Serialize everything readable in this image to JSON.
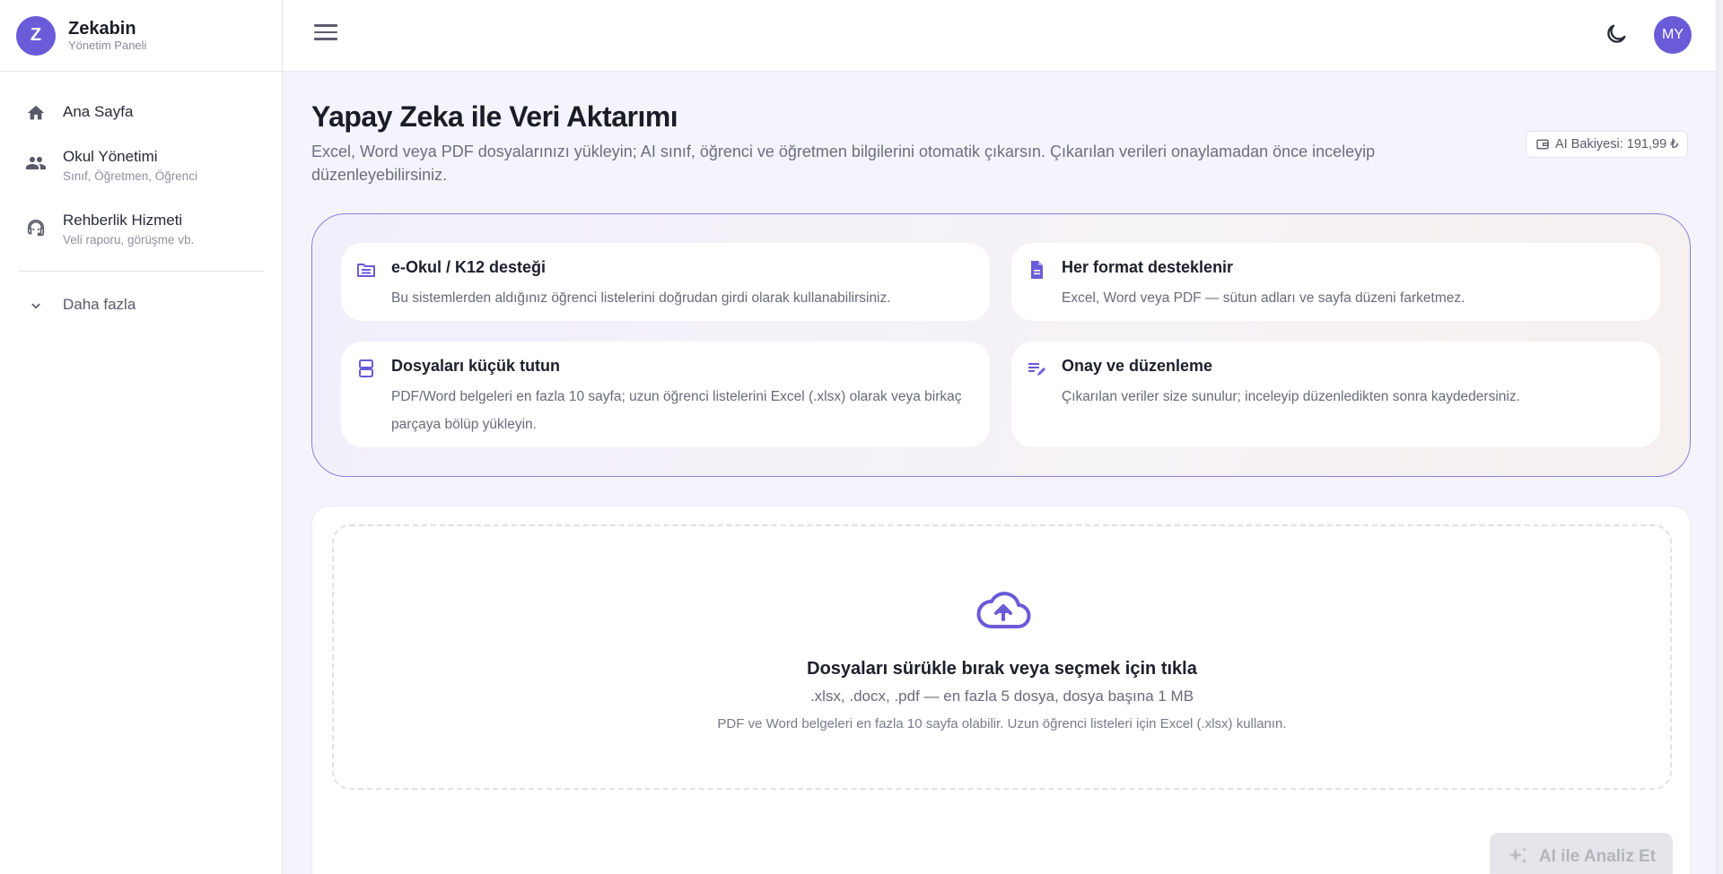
{
  "brand": {
    "logo_letter": "Z",
    "name": "Zekabin",
    "subtitle": "Yönetim Paneli"
  },
  "sidebar": {
    "items": [
      {
        "label": "Ana Sayfa",
        "sub": "",
        "icon": "home-icon"
      },
      {
        "label": "Okul Yönetimi",
        "sub": "Sınıf, Öğretmen, Öğrenci",
        "icon": "people-icon"
      },
      {
        "label": "Rehberlik Hizmeti",
        "sub": "Veli raporu, görüşme vb.",
        "icon": "support-agent-icon"
      }
    ],
    "more_label": "Daha fazla"
  },
  "topbar": {
    "avatar_initials": "MY",
    "theme_icon": "moon-icon",
    "menu_icon": "hamburger-icon"
  },
  "page": {
    "title": "Yapay Zeka ile Veri Aktarımı",
    "description": "Excel, Word veya PDF dosyalarınızı yükleyin; AI sınıf, öğrenci ve öğretmen bilgilerini otomatik çıkarsın. Çıkarılan verileri onaylamadan önce inceleyip düzenleyebilirsiniz.",
    "balance": "AI Bakiyesi: 191,99 ₺"
  },
  "tips": [
    {
      "title": "e-Okul / K12 desteği",
      "text": "Bu sistemlerden aldığınız öğrenci listelerini doğrudan girdi olarak kullanabilirsiniz.",
      "icon": "folder-open-icon"
    },
    {
      "title": "Her format desteklenir",
      "text": "Excel, Word veya PDF — sütun adları ve sayfa düzeni farketmez.",
      "icon": "document-icon"
    },
    {
      "title": "Dosyaları küçük tutun",
      "text": "PDF/Word belgeleri en fazla 10 sayfa; uzun öğrenci listelerini Excel (.xlsx) olarak veya birkaç parçaya bölüp yükleyin.",
      "icon": "split-pages-icon"
    },
    {
      "title": "Onay ve düzenleme",
      "text": "Çıkarılan veriler size sunulur; inceleyip düzenledikten sonra kaydedersiniz.",
      "icon": "edit-list-icon"
    }
  ],
  "upload": {
    "title": "Dosyaları sürükle bırak veya seçmek için tıkla",
    "formats": ".xlsx, .docx, .pdf — en fazla 5 dosya, dosya başına 1 MB",
    "note": "PDF ve Word belgeleri en fazla 10 sayfa olabilir. Uzun öğrenci listeleri için Excel (.xlsx) kullanın.",
    "icon": "cloud-upload-icon"
  },
  "analyze_button": "AI ile Analiz Et",
  "colors": {
    "accent": "#6a5bd8",
    "border_accent": "#8a80d6",
    "background": "#f5f4fc"
  }
}
